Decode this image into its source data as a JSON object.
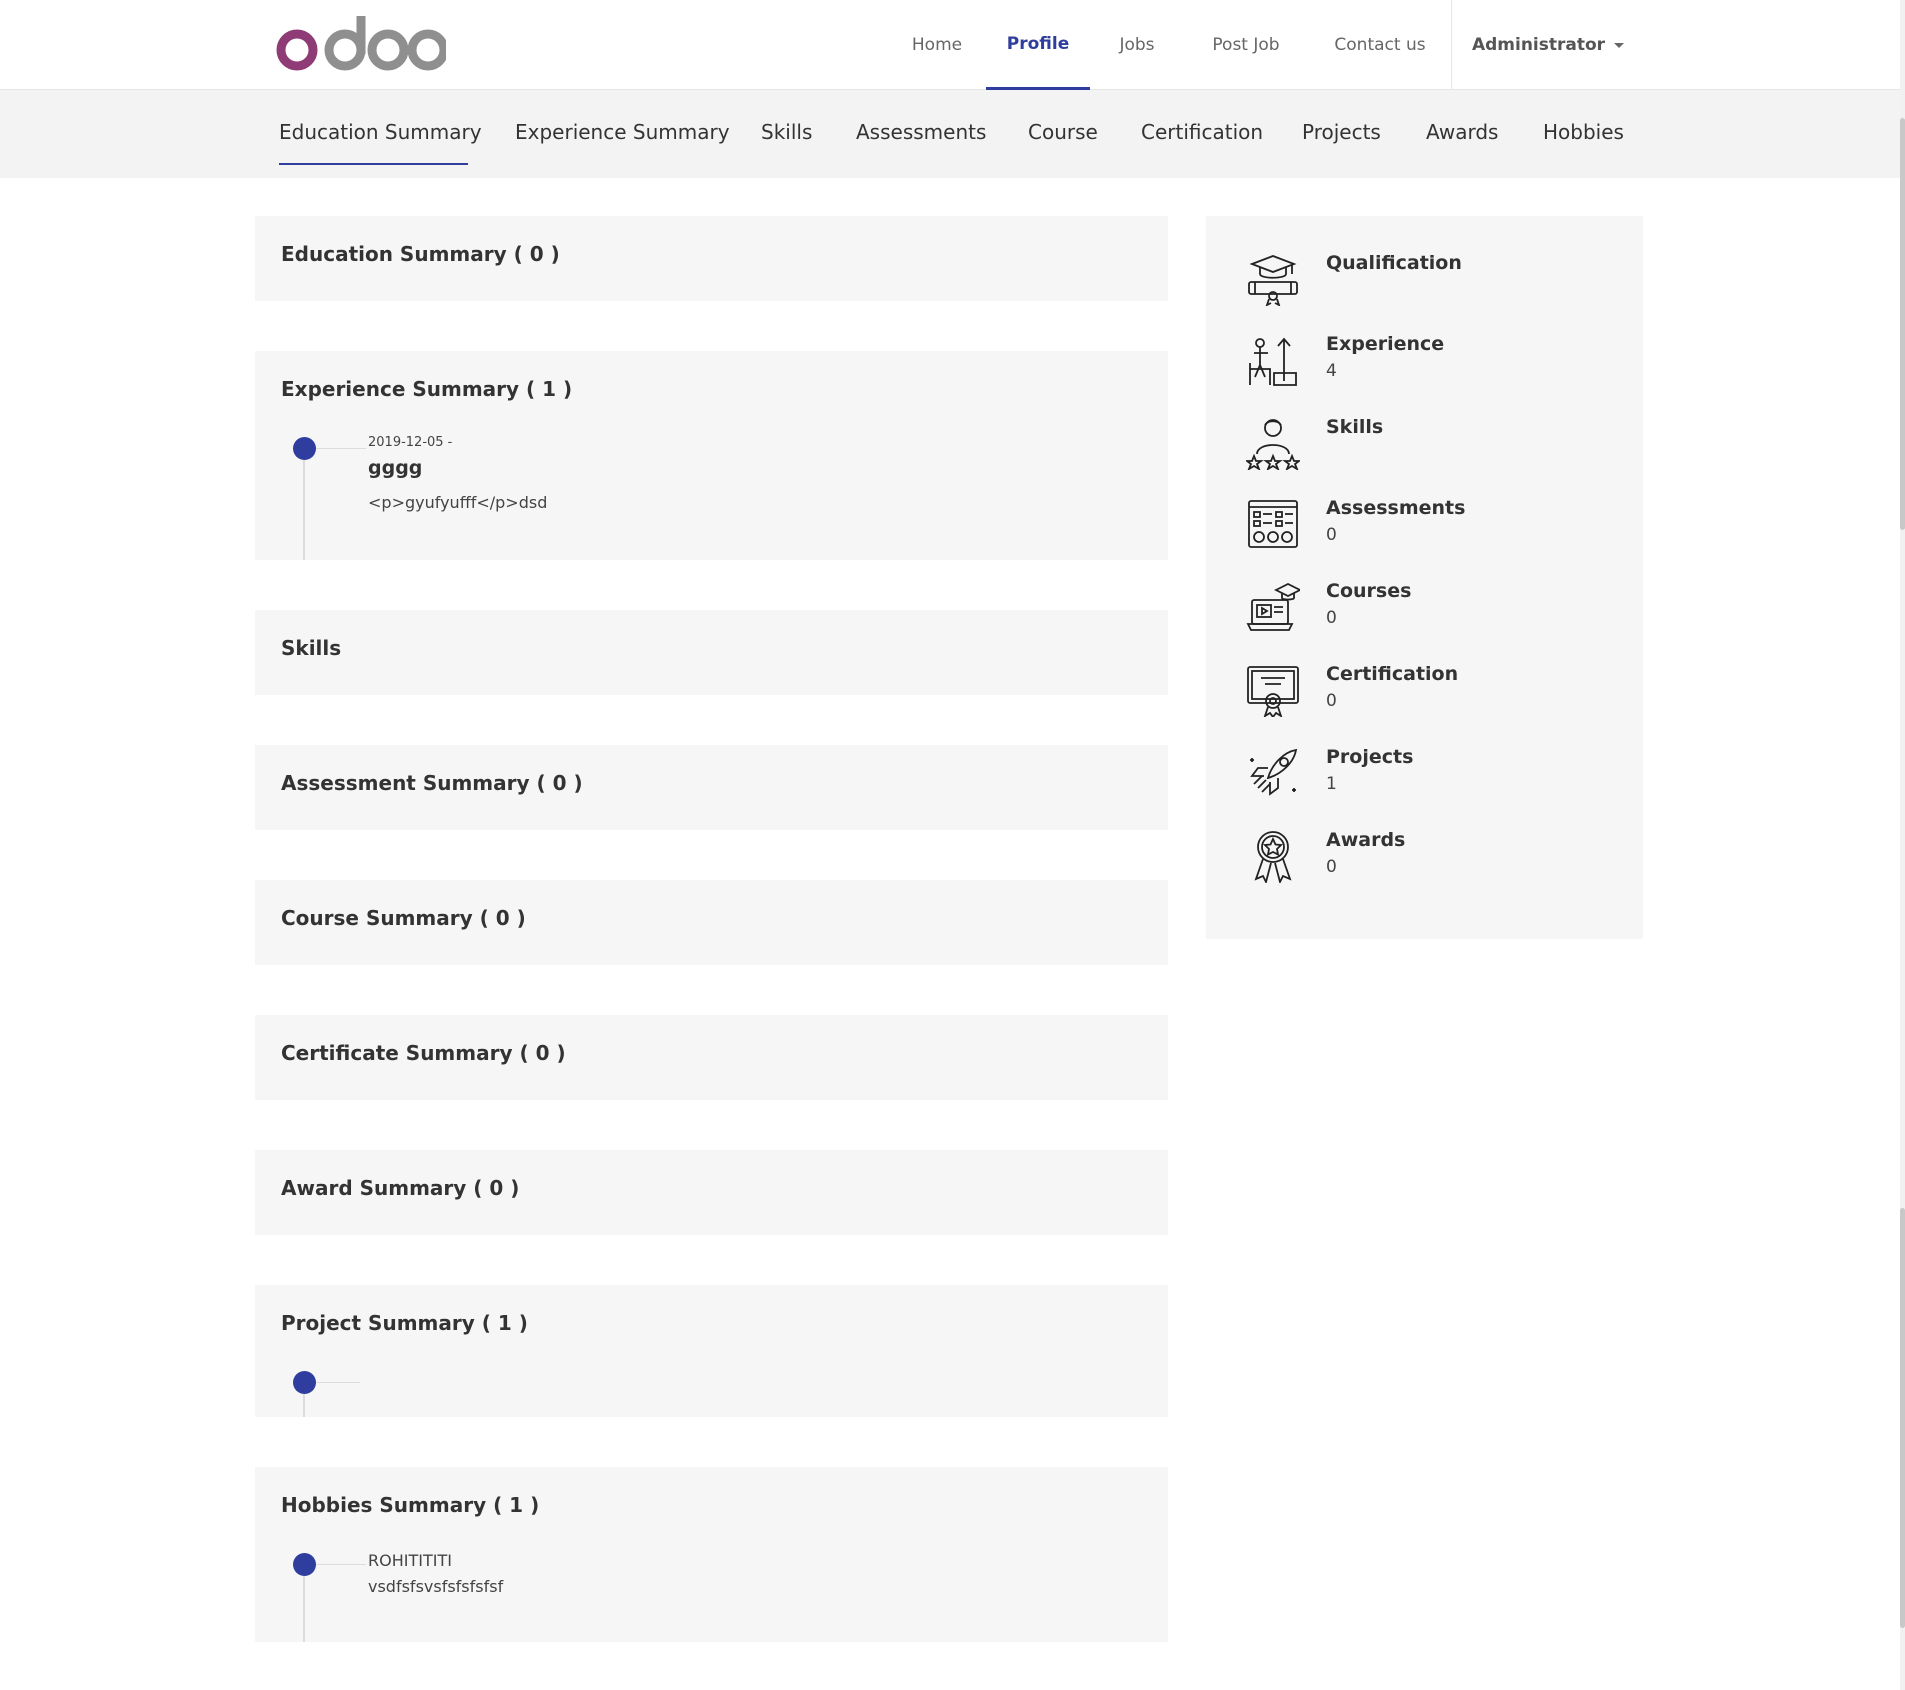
{
  "brand": {
    "logo_text": "odoo"
  },
  "nav": {
    "home": "Home",
    "profile": "Profile",
    "jobs": "Jobs",
    "post_job": "Post Job",
    "contact": "Contact us",
    "user": "Administrator"
  },
  "tabs": [
    "Education Summary",
    "Experience Summary",
    "Skills",
    "Assessments",
    "Course",
    "Certification",
    "Projects",
    "Awards",
    "Hobbies"
  ],
  "sections": {
    "education": {
      "title": "Education Summary ( 0 )"
    },
    "experience": {
      "title": "Experience Summary ( 1 )",
      "entries": [
        {
          "date": "2019-12-05 -",
          "heading": "gggg",
          "text": "<p>gyufyufff</p>dsd"
        }
      ]
    },
    "skills": {
      "title": "Skills"
    },
    "assessment": {
      "title": "Assessment Summary ( 0 )"
    },
    "course": {
      "title": "Course Summary ( 0 )"
    },
    "certificate": {
      "title": "Certificate Summary ( 0 )"
    },
    "award": {
      "title": "Award Summary ( 0 )"
    },
    "project": {
      "title": "Project Summary ( 1 )"
    },
    "hobbies": {
      "title": "Hobbies Summary ( 1 )",
      "entries": [
        {
          "name": "ROHITITITI",
          "text": "vsdfsfsvsfsfsfsfsf"
        }
      ]
    }
  },
  "stats": [
    {
      "label": "Qualification",
      "count": "",
      "icon": "graduation-cap-icon"
    },
    {
      "label": "Experience",
      "count": "4",
      "icon": "career-growth-icon"
    },
    {
      "label": "Skills",
      "count": "",
      "icon": "person-stars-icon"
    },
    {
      "label": "Assessments",
      "count": "0",
      "icon": "checklist-board-icon"
    },
    {
      "label": "Courses",
      "count": "0",
      "icon": "online-course-icon"
    },
    {
      "label": "Certification",
      "count": "0",
      "icon": "certificate-icon"
    },
    {
      "label": "Projects",
      "count": "1",
      "icon": "rocket-icon"
    },
    {
      "label": "Awards",
      "count": "0",
      "icon": "medal-icon"
    }
  ],
  "colors": {
    "accent": "#2f3e9e",
    "logo_o": "#8f3b76",
    "logo_doo": "#8f8f8f"
  }
}
